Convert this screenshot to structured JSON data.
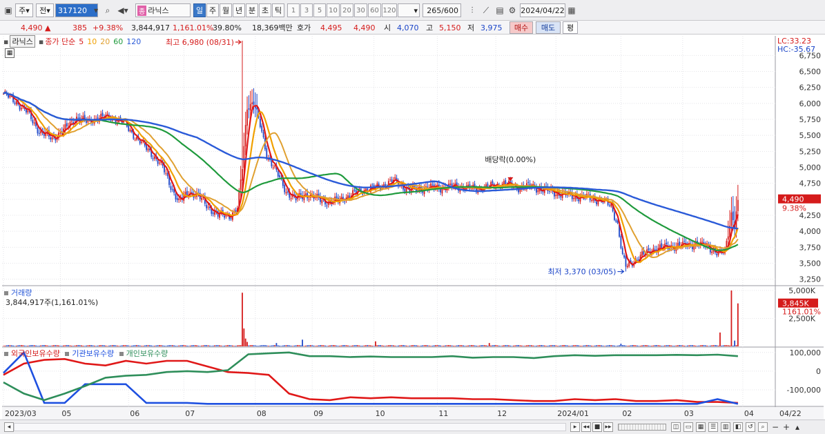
{
  "toolbar": {
    "period_labels": [
      "주",
      "전"
    ],
    "stock_code": "317120",
    "stock_name": "라닉스",
    "market_badge": "종",
    "periods": [
      "일",
      "주",
      "월",
      "년",
      "분",
      "초",
      "틱"
    ],
    "active_period": "일",
    "intervals": [
      "1",
      "3",
      "5",
      "10",
      "20",
      "30",
      "60",
      "120"
    ],
    "count": "265",
    "count_max": "/600",
    "date": "2024/04/22"
  },
  "quote": {
    "price": "4,490",
    "change_arrow": "▲",
    "change": "385",
    "change_pct": "+9.38%",
    "volume": "3,844,917",
    "volume_ratio": "1,161.01%",
    "turnover": "39.80%",
    "amount": "18,369백만",
    "ask_label": "호가",
    "ask": "4,495",
    "bid": "4,490",
    "open_label": "시",
    "open": "4,070",
    "high_label": "고",
    "high": "5,150",
    "low_label": "저",
    "low": "3,975",
    "buy_label": "매수",
    "sell_label": "매도",
    "eval_label": "평"
  },
  "legend": {
    "stock": "라닉스",
    "title": "종가 단순",
    "ma": [
      "5",
      "10",
      "20",
      "60",
      "120"
    ]
  },
  "annotations": {
    "high": "최고 6,980 (08/31)",
    "low": "최저 3,370 (03/05)",
    "dividend": "배당락(0.00%)",
    "lc": "LC:33.23",
    "hc": "HC:-35.67",
    "price_tag": "4,490",
    "pct_tag": "9.38%",
    "vol_tag": "3,845K",
    "vol_pct_tag": "1161.01%"
  },
  "volume_panel": {
    "title": "거래량",
    "subtitle": "3,844,917주(1,161.01%)"
  },
  "holdings_panel": {
    "series": [
      "외국인보유수량",
      "기관보유수량",
      "개인보유수량"
    ]
  },
  "colors": {
    "up": "#d51b1b",
    "down": "#1f48c8",
    "ma5": "#e01818",
    "ma10": "#f0a000",
    "ma20": "#e0a030",
    "ma60": "#1e9a3c",
    "ma120": "#2a5ad8",
    "foreign": "#e01818",
    "institution": "#1e50e0",
    "individual": "#2e8e5a"
  },
  "chart_data": [
    {
      "type": "candlestick",
      "price_ticks": [
        6750,
        6500,
        6250,
        6000,
        5750,
        5500,
        5250,
        5000,
        4750,
        4500,
        4250,
        4000,
        3750,
        3500,
        3250
      ],
      "ylim": [
        3160,
        6980
      ],
      "x_labels": [
        "2023/03",
        "05",
        "06",
        "07",
        "08",
        "09",
        "10",
        "11",
        "12",
        "2024/01",
        "02",
        "03",
        "04",
        "04/22"
      ],
      "x_label_index": [
        0,
        35,
        77,
        111,
        155,
        190,
        228,
        267,
        303,
        340,
        380,
        418,
        455,
        475
      ],
      "close_anchors": [
        [
          0,
          6150
        ],
        [
          8,
          6020
        ],
        [
          15,
          5850
        ],
        [
          22,
          5560
        ],
        [
          30,
          5450
        ],
        [
          38,
          5600
        ],
        [
          45,
          5780
        ],
        [
          52,
          5700
        ],
        [
          58,
          5780
        ],
        [
          66,
          5780
        ],
        [
          74,
          5700
        ],
        [
          82,
          5450
        ],
        [
          90,
          5250
        ],
        [
          98,
          5000
        ],
        [
          104,
          4650
        ],
        [
          108,
          4450
        ],
        [
          114,
          4620
        ],
        [
          120,
          4550
        ],
        [
          126,
          4380
        ],
        [
          132,
          4250
        ],
        [
          140,
          4250
        ],
        [
          144,
          4350
        ],
        [
          147,
          5000
        ],
        [
          150,
          5950
        ],
        [
          154,
          6020
        ],
        [
          158,
          5650
        ],
        [
          162,
          5200
        ],
        [
          166,
          5020
        ],
        [
          170,
          4820
        ],
        [
          174,
          4620
        ],
        [
          180,
          4500
        ],
        [
          186,
          4580
        ],
        [
          192,
          4520
        ],
        [
          200,
          4450
        ],
        [
          206,
          4480
        ],
        [
          214,
          4570
        ],
        [
          222,
          4650
        ],
        [
          232,
          4700
        ],
        [
          240,
          4790
        ],
        [
          250,
          4640
        ],
        [
          260,
          4680
        ],
        [
          270,
          4680
        ],
        [
          280,
          4700
        ],
        [
          290,
          4660
        ],
        [
          300,
          4700
        ],
        [
          308,
          4750
        ],
        [
          316,
          4680
        ],
        [
          324,
          4700
        ],
        [
          332,
          4650
        ],
        [
          340,
          4600
        ],
        [
          350,
          4550
        ],
        [
          360,
          4520
        ],
        [
          368,
          4480
        ],
        [
          374,
          4400
        ],
        [
          378,
          4100
        ],
        [
          381,
          3600
        ],
        [
          383,
          3450
        ],
        [
          387,
          3520
        ],
        [
          393,
          3620
        ],
        [
          400,
          3720
        ],
        [
          410,
          3760
        ],
        [
          418,
          3780
        ],
        [
          426,
          3800
        ],
        [
          434,
          3760
        ],
        [
          440,
          3640
        ],
        [
          444,
          3680
        ],
        [
          448,
          4280
        ],
        [
          450,
          4100
        ],
        [
          452,
          4490
        ]
      ],
      "moving_averages": [
        "5",
        "10",
        "20",
        "60",
        "120"
      ]
    },
    {
      "type": "bar",
      "title": "거래량",
      "ticks": [
        "5,000K",
        "2,500K"
      ],
      "ylim": [
        0,
        5000
      ],
      "unit": "K",
      "spikes": [
        [
          147,
          4800
        ],
        [
          148,
          1600
        ],
        [
          149,
          700
        ],
        [
          150,
          400
        ],
        [
          168,
          300
        ],
        [
          184,
          600
        ],
        [
          229,
          450
        ],
        [
          299,
          300
        ],
        [
          380,
          240
        ],
        [
          441,
          1240
        ],
        [
          448,
          5000
        ],
        [
          450,
          520
        ],
        [
          452,
          3845
        ]
      ]
    },
    {
      "type": "line",
      "ticks": [
        "100,000",
        "0",
        "-100,000"
      ],
      "ylim": [
        -185000,
        125000
      ],
      "series": [
        {
          "name": "외국인보유수량",
          "values": [
            -20000,
            40000,
            60000,
            65000,
            40000,
            30000,
            55000,
            40000,
            55000,
            55000,
            25000,
            -5000,
            -10000,
            -20000,
            -120000,
            -150000,
            -155000,
            -140000,
            -145000,
            -140000,
            -145000,
            -145000,
            -145000,
            -150000,
            -150000,
            -155000,
            -160000,
            -160000,
            -150000,
            -155000,
            -150000,
            -160000,
            -160000,
            -155000,
            -165000,
            -165000,
            -170000
          ]
        },
        {
          "name": "기관보유수량",
          "values": [
            -10000,
            100000,
            -170000,
            -170000,
            -70000,
            -70000,
            -70000,
            -170000,
            -170000,
            -170000,
            -175000,
            -175000,
            -175000,
            -175000,
            -175000,
            -175000,
            -175000,
            -175000,
            -175000,
            -175000,
            -175000,
            -175000,
            -175000,
            -175000,
            -175000,
            -175000,
            -175000,
            -175000,
            -175000,
            -175000,
            -175000,
            -175000,
            -175000,
            -175000,
            -175000,
            -150000,
            -175000
          ]
        },
        {
          "name": "개인보유수량",
          "values": [
            -60000,
            -120000,
            -155000,
            -120000,
            -80000,
            -35000,
            -25000,
            -20000,
            -5000,
            0,
            -5000,
            5000,
            90000,
            95000,
            100000,
            80000,
            80000,
            75000,
            78000,
            75000,
            75000,
            75000,
            80000,
            72000,
            75000,
            75000,
            70000,
            80000,
            85000,
            82000,
            85000,
            85000,
            85000,
            87000,
            85000,
            88000,
            80000
          ]
        }
      ]
    }
  ]
}
